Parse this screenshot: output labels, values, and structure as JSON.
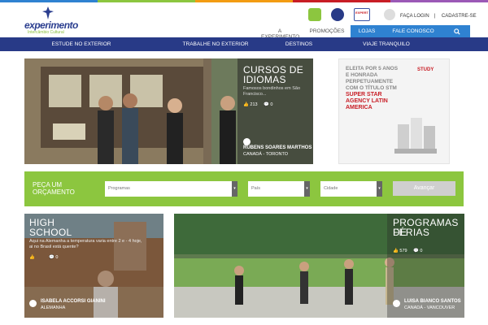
{
  "colors": {
    "navy": "#283a87",
    "blue": "#2f82d1",
    "green": "#8cc63f",
    "red": "#c81d25"
  },
  "logo": {
    "name": "experimento",
    "tagline": "Intercâmbio Cultural"
  },
  "top_badges": [
    "badge-1",
    "badge-2",
    "EXPERT"
  ],
  "login": {
    "login": "FAÇA LOGIN",
    "signup": "CADASTRE-SE"
  },
  "top_nav": [
    "A EXPERIMENTO",
    "PROMOÇÕES",
    "LOJAS",
    "FALE CONOSCO"
  ],
  "main_nav": [
    "ESTUDE NO EXTERIOR",
    "TRABALHE NO EXTERIOR",
    "DESTINOS",
    "VIAJE TRANQUILO"
  ],
  "cards": {
    "cursos": {
      "title_1": "CURSOS DE",
      "title_2": "IDIOMAS",
      "caption_1": "Famosos bondinhos em São",
      "caption_2": "Francisco...",
      "likes": "213",
      "comments": "0",
      "author": "RUBENS SOARES MARTHOS",
      "location": "CANADÁ - TORONTO"
    },
    "high": {
      "title_1": "HIGH",
      "title_2": "SCHOOL",
      "caption_1": "Aqui na Alemanha a temperatura varia entre 2 e - 4 hoje,",
      "caption_2": "ai no Brasil está quente?",
      "likes": "",
      "comments": "0",
      "author": "ISABELA ACCORSI GIANINI",
      "location": "ALEMANHA"
    },
    "ferias": {
      "title_1": "PROGRAMAS DE",
      "title_2": "FÉRIAS",
      "likes": "579",
      "comments": "0",
      "author": "LUISA BIANCO SANTOS",
      "location": "CANADÁ - VANCOUVER"
    }
  },
  "ad": {
    "l1": "ELEITA POR 5 ANOS",
    "l2": "E HONRADA",
    "l3": "PERPETUAMENTE",
    "l4": "COM O TÍTULO STM",
    "r1": "SUPER STAR",
    "r2": "AGENCY LATIN",
    "r3": "AMERICA",
    "badge": "STUDY"
  },
  "quote": {
    "label_1": "PEÇA UM",
    "label_2": "ORÇAMENTO",
    "programs": "Programas",
    "country": "País",
    "city": "Cidade",
    "button": "Avançar"
  }
}
